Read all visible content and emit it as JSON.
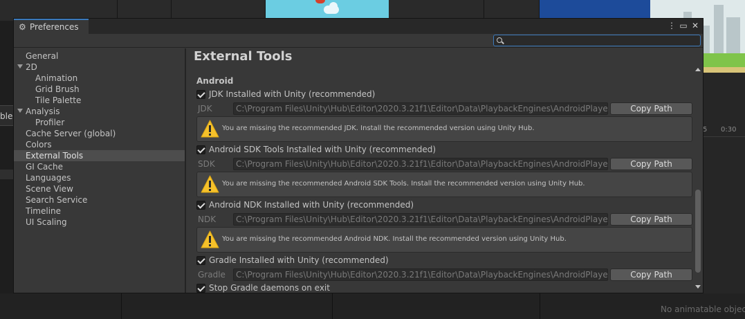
{
  "window": {
    "tab_title": "Preferences",
    "search": {
      "value": "",
      "placeholder": ""
    }
  },
  "sidebar": {
    "items": [
      {
        "label": "General"
      },
      {
        "label": "2D"
      },
      {
        "label": "Animation"
      },
      {
        "label": "Grid Brush"
      },
      {
        "label": "Tile Palette"
      },
      {
        "label": "Analysis"
      },
      {
        "label": "Profiler"
      },
      {
        "label": "Cache Server (global)"
      },
      {
        "label": "Colors"
      },
      {
        "label": "External Tools"
      },
      {
        "label": "GI Cache"
      },
      {
        "label": "Languages"
      },
      {
        "label": "Scene View"
      },
      {
        "label": "Search Service"
      },
      {
        "label": "Timeline"
      },
      {
        "label": "UI Scaling"
      }
    ],
    "selected": "External Tools"
  },
  "main": {
    "heading": "External Tools",
    "section": "Android",
    "jdk": {
      "check_label": "JDK Installed with Unity (recommended)",
      "checked": true,
      "path_label": "JDK",
      "path": "C:\\Program Files\\Unity\\Hub\\Editor\\2020.3.21f1\\Editor\\Data\\PlaybackEngines\\AndroidPlayer\\OpenJDK",
      "copy_label": "Copy Path",
      "warning": "You are missing the recommended JDK. Install the recommended version using Unity Hub."
    },
    "sdk": {
      "check_label": "Android SDK Tools Installed with Unity (recommended)",
      "checked": true,
      "path_label": "SDK",
      "path": "C:\\Program Files\\Unity\\Hub\\Editor\\2020.3.21f1\\Editor\\Data\\PlaybackEngines\\AndroidPlayer\\SDK",
      "copy_label": "Copy Path",
      "warning": "You are missing the recommended Android SDK Tools. Install the recommended version using Unity Hub."
    },
    "ndk": {
      "check_label": "Android NDK Installed with Unity (recommended)",
      "checked": true,
      "path_label": "NDK",
      "path": "C:\\Program Files\\Unity\\Hub\\Editor\\2020.3.21f1\\Editor\\Data\\PlaybackEngines\\AndroidPlayer\\NDK",
      "copy_label": "Copy Path",
      "warning": "You are missing the recommended Android NDK. Install the recommended version using Unity Hub."
    },
    "gradle": {
      "check_label": "Gradle Installed with Unity (recommended)",
      "checked": true,
      "path_label": "Gradle",
      "path": "C:\\Program Files\\Unity\\Hub\\Editor\\2020.3.21f1\\Editor\\Data\\PlaybackEngines\\AndroidPlayer\\Tools\\gradle",
      "copy_label": "Copy Path"
    },
    "stop_gradle": {
      "check_label": "Stop Gradle daemons on exit",
      "checked": true
    }
  },
  "background": {
    "left_strip_text": "ble",
    "timeline_ticks": [
      "5",
      "0:30"
    ],
    "bottom_note": "No animatable object"
  },
  "colors": {
    "accent": "#3a79bb",
    "warning": "#f6c12a"
  }
}
